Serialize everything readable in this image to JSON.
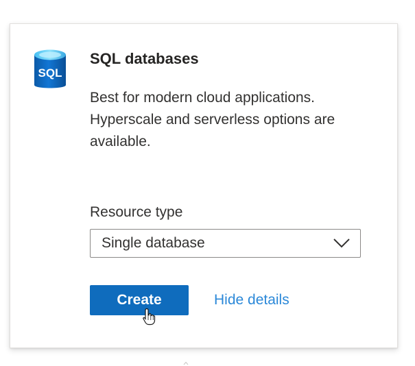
{
  "card": {
    "icon": {
      "name": "sql-database-icon",
      "label": "SQL",
      "color": "#0f6cbd",
      "top_color": "#59c6f5"
    },
    "title": "SQL databases",
    "description": "Best for modern cloud applications. Hyperscale and serverless options are available.",
    "resource_type": {
      "label": "Resource type",
      "selected": "Single database"
    },
    "actions": {
      "create_label": "Create",
      "hide_details_label": "Hide details"
    }
  },
  "colors": {
    "primary": "#0f6cbd",
    "link": "#2b88d8",
    "text": "#323130"
  },
  "icons": {
    "dropdown": "chevron-down-icon",
    "pointer": "hand-pointer-cursor-icon"
  }
}
